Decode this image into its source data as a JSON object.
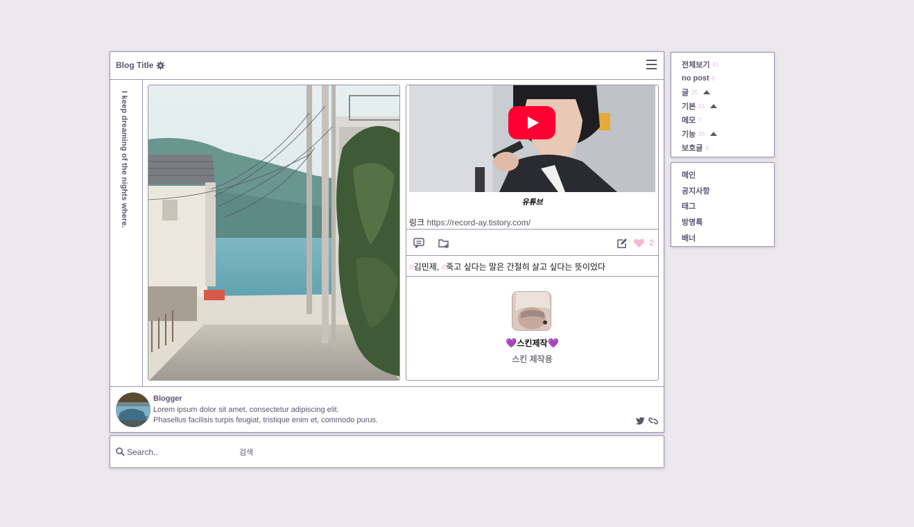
{
  "header": {
    "title": "Blog Title",
    "gear_icon": "gear-icon",
    "menu_icon": "hamburger-menu-icon"
  },
  "tagline": "I keep dreaming of the nights where.",
  "post": {
    "video_caption": "유튜브",
    "link_label": "링크",
    "link_url": "https://record-ay.tistory.com/",
    "like_count": "2",
    "tags": [
      {
        "hash": "#",
        "text": "김민제",
        "sep": ", "
      },
      {
        "hash": "#",
        "text": "죽고 싶다는 말은 간절히 살고 싶다는 뜻이었다",
        "sep": ""
      }
    ],
    "profile_name": "스킨제작",
    "profile_desc": "스킨 제작용"
  },
  "blogger": {
    "name": "Blogger",
    "bio_line1": "Lorem ipsum dolor sit amet, consectetur adipiscing elit.",
    "bio_line2": "Phasellus facilisis turpis feugiat, tristique enim et, commodo purus."
  },
  "search": {
    "placeholder": "Search..",
    "button_label": "검색"
  },
  "categories": [
    {
      "label": "전체보기",
      "count": "81",
      "caret": false
    },
    {
      "label": "no post",
      "count": "0",
      "caret": false
    },
    {
      "label": "글",
      "count": "25",
      "caret": true
    },
    {
      "label": "기본",
      "count": "21",
      "caret": true
    },
    {
      "label": "메모",
      "count": "7",
      "caret": false
    },
    {
      "label": "기능",
      "count": "25",
      "caret": true
    },
    {
      "label": "보호글",
      "count": "3",
      "caret": false
    }
  ],
  "nav": [
    "메인",
    "공지사항",
    "태그",
    "방명록",
    "배너"
  ],
  "colors": {
    "accent_text": "#5d5470",
    "border": "#9d94ab",
    "pink": "#f7b7d2",
    "background": "#ebe9ee"
  }
}
